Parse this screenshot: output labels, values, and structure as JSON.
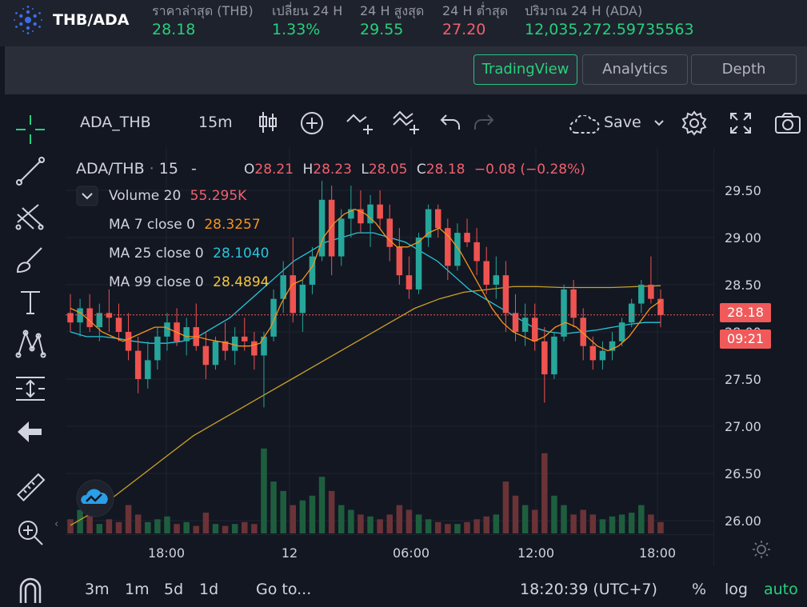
{
  "header": {
    "pair": "THB/ADA",
    "stats": [
      {
        "label": "ราคาล่าสุด (THB)",
        "value": "28.18",
        "tone": "green"
      },
      {
        "label": "เปลี่ยน 24 H",
        "value": "1.33%",
        "tone": "green"
      },
      {
        "label": "24 H สูงสุด",
        "value": "29.55",
        "tone": "green"
      },
      {
        "label": "24 H ต่ำสุด",
        "value": "27.20",
        "tone": "red"
      },
      {
        "label": "ปริมาณ 24 H (ADA)",
        "value": "12,035,272.59735563",
        "tone": "green"
      }
    ]
  },
  "tabs": [
    {
      "label": "TradingView",
      "active": true
    },
    {
      "label": "Analytics",
      "active": false
    },
    {
      "label": "Depth",
      "active": false
    }
  ],
  "toolbar": {
    "symbol": "ADA_THB",
    "interval": "15m",
    "save_label": "Save"
  },
  "legend": {
    "symbol": "ADA/THB",
    "interval": "15",
    "dash": "-",
    "o_label": "O",
    "o_value": "28.21",
    "h_label": "H",
    "h_value": "28.23",
    "l_label": "L",
    "l_value": "28.05",
    "c_label": "C",
    "c_value": "28.18",
    "change": "−0.08 (−0.28%)",
    "volume_label": "Volume 20",
    "volume_value": "55.295K",
    "ma7_label": "MA 7 close 0",
    "ma7_value": "28.3257",
    "ma25_label": "MA 25 close 0",
    "ma25_value": "28.1040",
    "ma99_label": "MA 99 close 0",
    "ma99_value": "28.4894"
  },
  "price_tag": {
    "price": "28.18",
    "countdown": "09:21"
  },
  "bottom": {
    "ranges": [
      "3m",
      "1m",
      "5d",
      "1d"
    ],
    "goto": "Go to...",
    "time": "18:20:39 (UTC+7)",
    "percent": "%",
    "log": "log",
    "auto": "auto"
  },
  "colors": {
    "up": "#26a69a",
    "down": "#ef5350",
    "up_volume": "#1e5e3e",
    "down_volume": "#6b3337",
    "ma7": "#f7931a",
    "ma25": "#26c6da",
    "ma99": "#c9a227",
    "accent": "#26d07c"
  },
  "icons": [
    "crosshair-icon",
    "trendline-icon",
    "fib-icon",
    "brush-icon",
    "text-icon",
    "pattern-icon",
    "measure-icon",
    "back-arrow-icon",
    "ruler-icon",
    "zoom-in-icon",
    "magnet-icon",
    "candles-icon",
    "add-indicator-icon",
    "compare-icon",
    "indicators-icon",
    "undo-icon",
    "redo-icon",
    "cloud-icon",
    "chevron-down-icon",
    "gear-icon",
    "fullscreen-icon",
    "camera-icon",
    "sun-icon"
  ],
  "chart_data": {
    "type": "candlestick",
    "y_ticks": [
      "29.50",
      "29.00",
      "28.50",
      "28.00",
      "27.50",
      "27.00",
      "26.50",
      "26.00"
    ],
    "x_ticks": [
      "18:00",
      "12",
      "06:00",
      "12:00",
      "18:00"
    ],
    "ylim": [
      25.9,
      29.8
    ],
    "last_price": 28.18,
    "candles": [
      [
        28.2,
        28.4,
        28.0,
        28.1
      ],
      [
        28.1,
        28.35,
        27.95,
        28.25
      ],
      [
        28.25,
        28.4,
        28.0,
        28.05
      ],
      [
        28.05,
        28.3,
        27.9,
        28.2
      ],
      [
        28.2,
        28.45,
        28.0,
        28.15
      ],
      [
        28.15,
        28.3,
        27.9,
        28.0
      ],
      [
        28.0,
        28.2,
        27.7,
        27.8
      ],
      [
        27.8,
        27.95,
        27.35,
        27.5
      ],
      [
        27.5,
        27.9,
        27.4,
        27.7
      ],
      [
        27.7,
        28.05,
        27.6,
        27.95
      ],
      [
        27.95,
        28.2,
        27.8,
        28.1
      ],
      [
        28.1,
        28.25,
        27.85,
        27.9
      ],
      [
        27.9,
        28.15,
        27.75,
        28.05
      ],
      [
        28.05,
        28.3,
        27.8,
        27.85
      ],
      [
        27.85,
        28.0,
        27.5,
        27.65
      ],
      [
        27.65,
        27.95,
        27.6,
        27.9
      ],
      [
        27.9,
        28.1,
        27.7,
        27.8
      ],
      [
        27.8,
        28.05,
        27.65,
        27.95
      ],
      [
        27.95,
        28.15,
        27.8,
        27.9
      ],
      [
        27.9,
        28.0,
        27.6,
        27.75
      ],
      [
        27.75,
        28.0,
        27.2,
        27.95
      ],
      [
        27.95,
        28.45,
        27.9,
        28.35
      ],
      [
        28.35,
        28.75,
        28.2,
        28.6
      ],
      [
        28.6,
        29.0,
        28.1,
        28.2
      ],
      [
        28.2,
        28.55,
        28.0,
        28.5
      ],
      [
        28.5,
        28.9,
        28.4,
        28.8
      ],
      [
        28.8,
        29.6,
        28.75,
        29.4
      ],
      [
        29.4,
        29.55,
        28.6,
        28.8
      ],
      [
        28.8,
        29.3,
        28.7,
        29.2
      ],
      [
        29.2,
        29.55,
        29.0,
        29.3
      ],
      [
        29.3,
        29.5,
        29.05,
        29.15
      ],
      [
        29.15,
        29.45,
        28.9,
        29.35
      ],
      [
        29.35,
        29.5,
        29.1,
        29.2
      ],
      [
        29.2,
        29.35,
        28.75,
        28.9
      ],
      [
        28.9,
        29.1,
        28.5,
        28.6
      ],
      [
        28.6,
        28.8,
        28.35,
        28.45
      ],
      [
        28.45,
        29.05,
        28.4,
        29.0
      ],
      [
        29.0,
        29.35,
        28.9,
        29.3
      ],
      [
        29.3,
        29.35,
        29.0,
        29.1
      ],
      [
        29.1,
        29.2,
        28.55,
        28.7
      ],
      [
        28.7,
        29.15,
        28.65,
        29.05
      ],
      [
        29.05,
        29.2,
        28.9,
        28.95
      ],
      [
        28.95,
        29.1,
        28.6,
        28.75
      ],
      [
        28.75,
        28.9,
        28.4,
        28.5
      ],
      [
        28.5,
        28.8,
        28.35,
        28.6
      ],
      [
        28.6,
        28.75,
        28.0,
        28.2
      ],
      [
        28.2,
        28.4,
        27.9,
        28.0
      ],
      [
        28.0,
        28.3,
        27.85,
        28.15
      ],
      [
        28.15,
        28.3,
        27.8,
        27.9
      ],
      [
        27.9,
        28.05,
        27.25,
        27.55
      ],
      [
        27.55,
        28.0,
        27.5,
        27.95
      ],
      [
        27.95,
        28.5,
        27.9,
        28.45
      ],
      [
        28.45,
        28.55,
        28.05,
        28.15
      ],
      [
        28.15,
        28.25,
        27.7,
        27.85
      ],
      [
        27.85,
        27.95,
        27.6,
        27.7
      ],
      [
        27.7,
        27.9,
        27.6,
        27.8
      ],
      [
        27.8,
        28.0,
        27.7,
        27.9
      ],
      [
        27.9,
        28.15,
        27.85,
        28.1
      ],
      [
        28.1,
        28.35,
        28.05,
        28.3
      ],
      [
        28.3,
        28.55,
        28.2,
        28.5
      ],
      [
        28.5,
        28.8,
        28.3,
        28.35
      ],
      [
        28.35,
        28.45,
        28.05,
        28.18
      ]
    ],
    "ma7": [
      28.25,
      28.2,
      28.1,
      28.0,
      27.95,
      27.9,
      27.95,
      28.0,
      28.05,
      28.05,
      28.0,
      27.95,
      27.95,
      27.92,
      27.9,
      27.88,
      27.85,
      27.85,
      27.88,
      28.05,
      28.3,
      28.5,
      28.55,
      28.7,
      29.0,
      29.15,
      29.25,
      29.3,
      29.25,
      29.15,
      29.0,
      28.9,
      28.9,
      28.95,
      29.05,
      29.1,
      29.0,
      28.85,
      28.65,
      28.45,
      28.25,
      28.1,
      28.0,
      27.95,
      27.9,
      27.95,
      28.05,
      28.1,
      28.05,
      27.95,
      27.85,
      27.8,
      27.85,
      27.95,
      28.1,
      28.25,
      28.33
    ],
    "ma25": [
      28.0,
      27.95,
      27.95,
      27.93,
      27.9,
      27.88,
      27.88,
      27.9,
      27.95,
      28.05,
      28.15,
      28.3,
      28.45,
      28.6,
      28.75,
      28.85,
      28.95,
      29.0,
      29.05,
      29.05,
      29.0,
      28.95,
      28.85,
      28.75,
      28.6,
      28.45,
      28.35,
      28.25,
      28.15,
      28.05,
      28.0,
      27.98,
      28.0,
      28.02,
      28.05,
      28.08,
      28.1,
      28.1
    ],
    "ma99": [
      25.95,
      26.1,
      26.3,
      26.5,
      26.7,
      26.9,
      27.05,
      27.2,
      27.35,
      27.5,
      27.65,
      27.8,
      27.95,
      28.1,
      28.25,
      28.35,
      28.42,
      28.45,
      28.48,
      28.48,
      28.47,
      28.47,
      28.47,
      28.48,
      28.49
    ],
    "volume": [
      0.15,
      0.25,
      0.2,
      0.1,
      0.15,
      0.12,
      0.3,
      0.2,
      0.12,
      0.15,
      0.18,
      0.1,
      0.12,
      0.08,
      0.22,
      0.1,
      0.08,
      0.1,
      0.12,
      0.1,
      0.9,
      0.55,
      0.45,
      0.3,
      0.35,
      0.4,
      0.6,
      0.45,
      0.3,
      0.25,
      0.2,
      0.18,
      0.15,
      0.2,
      0.3,
      0.25,
      0.2,
      0.15,
      0.12,
      0.1,
      0.1,
      0.12,
      0.15,
      0.18,
      0.2,
      0.55,
      0.4,
      0.3,
      0.25,
      0.85,
      0.4,
      0.3,
      0.2,
      0.25,
      0.2,
      0.15,
      0.18,
      0.2,
      0.22,
      0.3,
      0.2,
      0.12
    ]
  }
}
